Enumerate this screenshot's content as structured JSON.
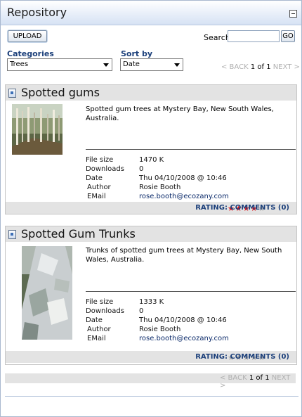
{
  "title": "Repository",
  "toolbar": {
    "upload_label": "UPLOAD",
    "search_label": "Search",
    "search_value": "",
    "go_label": "GO"
  },
  "filters": {
    "categories_label": "Categories",
    "categories_value": "Trees",
    "sort_label": "Sort by",
    "sort_value": "Date"
  },
  "pager": {
    "back": "< BACK",
    "page": "1",
    "of": "of",
    "total": "1",
    "next": "NEXT >"
  },
  "meta_labels": {
    "size": "File size",
    "downloads": "Downloads",
    "date": "Date",
    "author": "Author",
    "email": "EMail"
  },
  "footer_labels": {
    "rating": "RATING:"
  },
  "items": [
    {
      "title": "Spotted gums",
      "description": "Spotted gum trees at Mystery Bay, New South Wales, Australia.",
      "size": "1470 K",
      "downloads": "0",
      "date": "Thu 04/10/2008 @ 10:46",
      "author": "Rosie Booth",
      "email": "rose.booth@ecozany.com",
      "rating": 4,
      "rating_max": 5,
      "comments": "COMMENTS (0)"
    },
    {
      "title": "Spotted Gum Trunks",
      "description": "Trunks of spotted gum trees at Mystery Bay, New South Wales, Australia.",
      "size": "1333 K",
      "downloads": "0",
      "date": "Thu 04/10/2008 @ 10:46",
      "author": "Rosie Booth",
      "email": "rose.booth@ecozany.com",
      "rating": 0,
      "rating_max": 5,
      "comments": "COMMENTS (0)"
    }
  ],
  "colors": {
    "star_on": "#e0141a",
    "star_off": "#a6a6a6",
    "label_blue": "#1b3f7a"
  }
}
